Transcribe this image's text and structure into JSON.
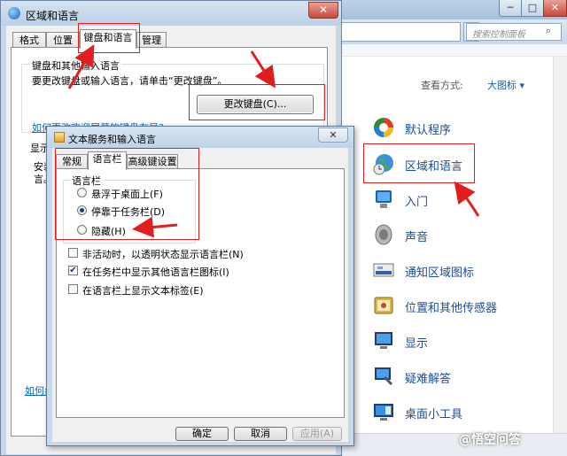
{
  "control_panel": {
    "search_placeholder": "搜索控制面板",
    "view_by_label": "查看方式:",
    "view_by_value": "大图标 ▾",
    "items": [
      {
        "label": "默认程序",
        "icon": "default-programs-icon"
      },
      {
        "label": "区域和语言",
        "icon": "region-language-icon"
      },
      {
        "label": "入门",
        "icon": "getting-started-icon"
      },
      {
        "label": "声音",
        "icon": "sound-icon"
      },
      {
        "label": "通知区域图标",
        "icon": "notification-area-icon"
      },
      {
        "label": "位置和其他传感器",
        "icon": "location-sensors-icon"
      },
      {
        "label": "显示",
        "icon": "display-icon"
      },
      {
        "label": "疑难解答",
        "icon": "troubleshooting-icon"
      },
      {
        "label": "桌面小工具",
        "icon": "desktop-gadgets-icon"
      }
    ],
    "window_buttons": {
      "minimize": "─",
      "maximize": "□",
      "close": "✕"
    }
  },
  "region_language": {
    "title": "区域和语言",
    "close": "✕",
    "tabs": [
      "格式",
      "位置",
      "键盘和语言",
      "管理"
    ],
    "selected_tab": "键盘和语言",
    "group_keyboard_label": "键盘和其他输入语言",
    "group_keyboard_text": "要更改键盘或输入语言，请单击“更改键盘”。",
    "change_keyboard_button": "更改键盘(C)...",
    "link_welcome": "如何更改欢迎屏幕的键盘布局?",
    "display_language_label": "显示",
    "frag1": "安装",
    "frag2": "言。",
    "link_bottom": "如何纟"
  },
  "text_services": {
    "title": "文本服务和输入语言",
    "close": "✕",
    "tabs": [
      "常规",
      "语言栏",
      "高级键设置"
    ],
    "selected_tab": "语言栏",
    "group_label": "语言栏",
    "radios": [
      {
        "label": "悬浮于桌面上(F)",
        "checked": false
      },
      {
        "label": "停靠于任务栏(D)",
        "checked": true
      },
      {
        "label": "隐藏(H)",
        "checked": false
      }
    ],
    "checkboxes": [
      {
        "label": "非活动时，以透明状态显示语言栏(N)",
        "checked": false
      },
      {
        "label": "在任务栏中显示其他语言栏图标(I)",
        "checked": true
      },
      {
        "label": "在语言栏上显示文本标签(E)",
        "checked": false
      }
    ],
    "check_mark": "✔",
    "buttons": {
      "ok": "确定",
      "cancel": "取消",
      "apply": "应用(A)"
    }
  },
  "watermark": "@悟空问答"
}
